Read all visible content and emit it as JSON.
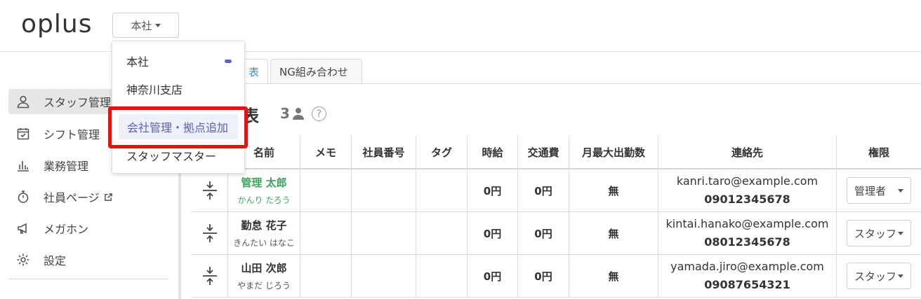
{
  "header": {
    "logo": "oplus",
    "branch_button": "本社"
  },
  "dropdown": {
    "items": [
      "本社",
      "神奈川支店",
      "会社管理・拠点追加",
      "スタッフマスター"
    ]
  },
  "sidebar": {
    "items": [
      {
        "label": "スタッフ管理",
        "icon": "user-icon"
      },
      {
        "label": "シフト管理",
        "icon": "calendar-check-icon"
      },
      {
        "label": "業務管理",
        "icon": "bar-chart-icon"
      },
      {
        "label": "社員ページ",
        "icon": "stopwatch-icon"
      },
      {
        "label": "メガホン",
        "icon": "megaphone-icon"
      },
      {
        "label": "設定",
        "icon": "gear-icon"
      }
    ]
  },
  "tabs": [
    "表",
    "NG組み合わせ"
  ],
  "page": {
    "title": "表",
    "count": "3",
    "help": "?"
  },
  "table": {
    "headers": [
      "名前",
      "メモ",
      "社員番号",
      "タグ",
      "時給",
      "交通費",
      "月最大出勤数",
      "連絡先",
      "権限"
    ],
    "rows": [
      {
        "name": "管理 太郎",
        "kana": "かんり たろう",
        "memo": "",
        "number": "",
        "tag": "",
        "wage": "0円",
        "transport": "0円",
        "max": "無",
        "email": "kanri.taro@example.com",
        "phone": "09012345678",
        "role": "管理者",
        "admin": true
      },
      {
        "name": "勤怠 花子",
        "kana": "きんたい はなこ",
        "memo": "",
        "number": "",
        "tag": "",
        "wage": "0円",
        "transport": "0円",
        "max": "無",
        "email": "kintai.hanako@example.com",
        "phone": "08012345678",
        "role": "スタッフ",
        "admin": false
      },
      {
        "name": "山田 次郎",
        "kana": "やまだ じろう",
        "memo": "",
        "number": "",
        "tag": "",
        "wage": "0円",
        "transport": "0円",
        "max": "無",
        "email": "yamada.jiro@example.com",
        "phone": "09087654321",
        "role": "スタッフ",
        "admin": false
      }
    ]
  },
  "colors": {
    "accent": "#5b5fd6",
    "admin_green": "#3aa55b",
    "highlight_red": "#e8110f",
    "tab_blue": "#3a8fd1"
  }
}
